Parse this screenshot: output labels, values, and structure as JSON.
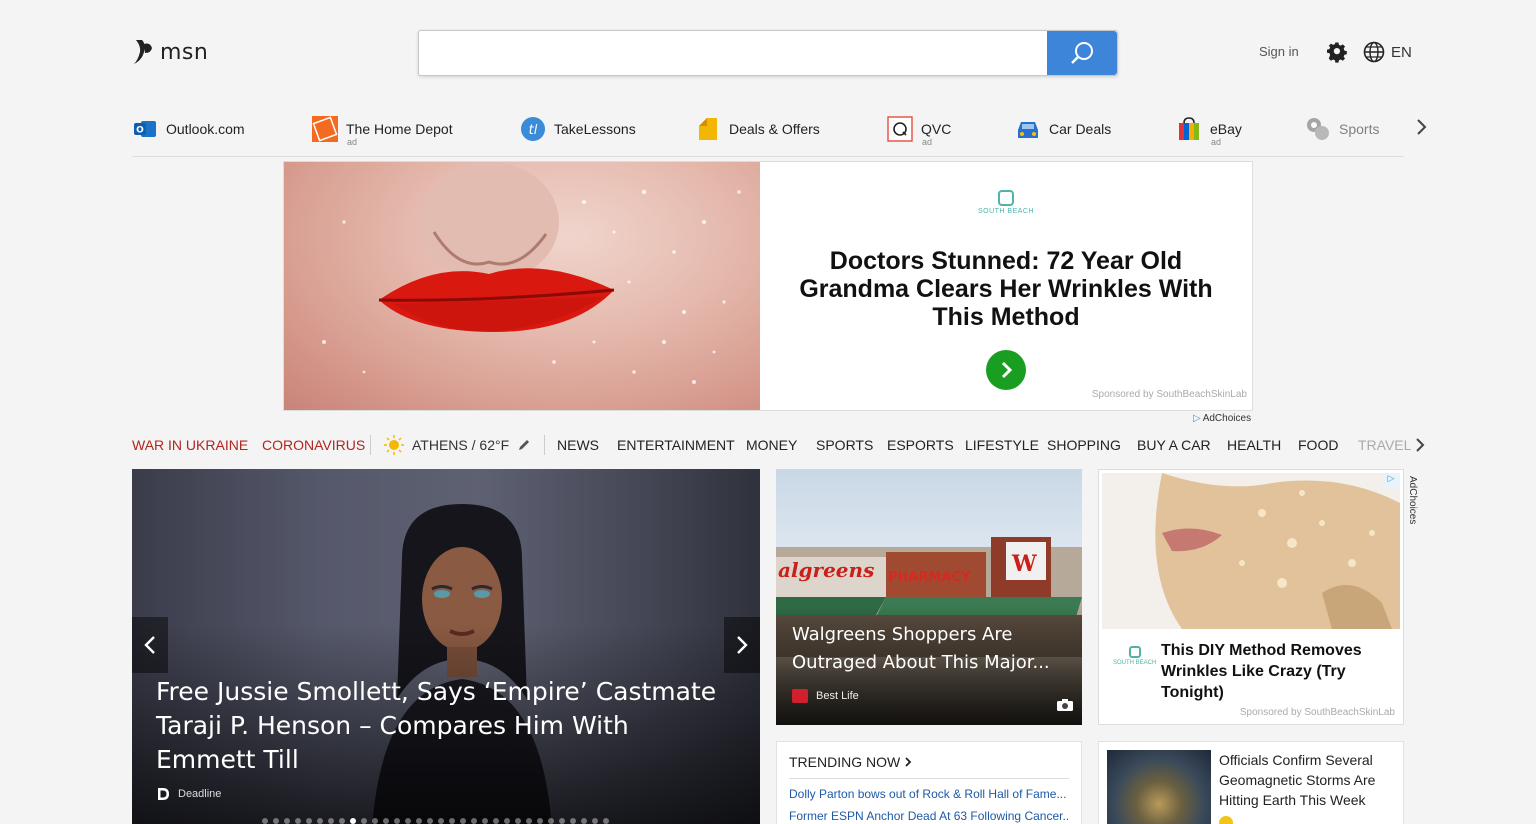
{
  "header": {
    "logo_text": "msn",
    "search_placeholder": "",
    "signin": "Sign in",
    "language": "EN"
  },
  "quicklinks": [
    {
      "label": "Outlook.com",
      "ad": ""
    },
    {
      "label": "The Home Depot",
      "ad": "ad"
    },
    {
      "label": "TakeLessons",
      "ad": ""
    },
    {
      "label": "Deals & Offers",
      "ad": ""
    },
    {
      "label": "QVC",
      "ad": "ad"
    },
    {
      "label": "Car Deals",
      "ad": ""
    },
    {
      "label": "eBay",
      "ad": "ad"
    },
    {
      "label": "Sports",
      "ad": ""
    }
  ],
  "banner": {
    "brand": "SOUTH BEACH",
    "headline": "Doctors Stunned: 72 Year Old Grandma Clears Her Wrinkles With This Method",
    "sponsor": "Sponsored by SouthBeachSkinLab",
    "adchoices": "AdChoices"
  },
  "nav": {
    "war": "WAR IN UKRAINE",
    "corona": "CORONAVIRUS",
    "weather": "ATHENS / 62°F",
    "items": [
      "NEWS",
      "ENTERTAINMENT",
      "MONEY",
      "SPORTS",
      "ESPORTS",
      "LIFESTYLE",
      "SHOPPING",
      "BUY A CAR",
      "HEALTH",
      "FOOD",
      "TRAVEL"
    ]
  },
  "hero": {
    "title": "Free Jussie Smollett, Says ‘Empire’ Castmate Taraji P. Henson – Compares Him With Emmett Till",
    "source": "Deadline",
    "dots": 32,
    "active_dot": 8
  },
  "card1": {
    "title": "Walgreens Shoppers Are Outraged About This Major...",
    "source": "Best Life"
  },
  "card2": {
    "brand": "SOUTH BEACH",
    "title": "This DIY Method Removes Wrinkles Like Crazy (Try Tonight)",
    "sponsor": "Sponsored by SouthBeachSkinLab",
    "adchoices": "AdChoices"
  },
  "trending": {
    "heading": "TRENDING NOW",
    "items": [
      "Dolly Parton bows out of Rock & Roll Hall of Fame...",
      "Former ESPN Anchor Dead At 63 Following Cancer..."
    ]
  },
  "story": {
    "title": "Officials Confirm Several Geomagnetic Storms Are Hitting Earth This Week"
  },
  "colors": {
    "accent_blue": "#3c85d8",
    "nav_red": "#b3251e",
    "go_green": "#1a9e22"
  }
}
